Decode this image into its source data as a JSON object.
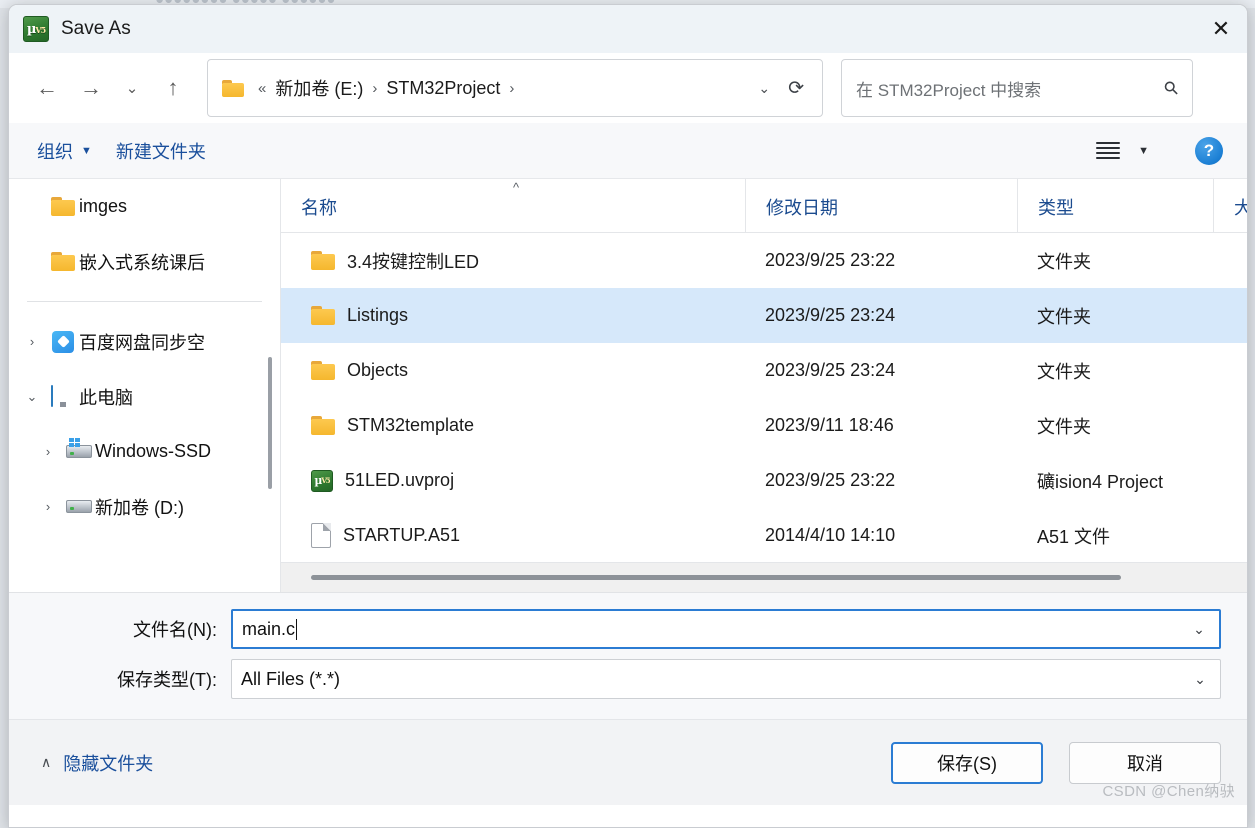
{
  "background": {
    "ghost_text": "●●●●●●●● ●●●●● ●●●●●●"
  },
  "titlebar": {
    "app_icon": "keil-uvision-icon",
    "title": "Save As",
    "close_label": "✕"
  },
  "nav": {
    "back": "←",
    "forward": "→",
    "recent": "⌄",
    "up": "↑",
    "address": {
      "folder_icon": "folder-icon",
      "prefix": "«",
      "crumbs": [
        {
          "label": "新加卷 (E:)",
          "sep": "›"
        },
        {
          "label": "STM32Project",
          "sep": "›"
        }
      ],
      "history_chev": "⌄",
      "refresh": "⟳"
    },
    "search": {
      "placeholder": "在 STM32Project 中搜索",
      "icon": "search-icon"
    }
  },
  "toolbar": {
    "organize_label": "组织",
    "organize_caret": "▼",
    "new_folder_label": "新建文件夹",
    "view_caret": "▼",
    "help_label": "?"
  },
  "sidebar": {
    "items": [
      {
        "chev": "",
        "icon": "folder-icon",
        "label": "imges",
        "indent": false
      },
      {
        "chev": "",
        "icon": "folder-icon",
        "label": "嵌入式系统课后",
        "indent": false
      },
      {
        "separator": true
      },
      {
        "chev": "›",
        "icon": "cloud-icon",
        "label": "百度网盘同步空",
        "indent": false
      },
      {
        "chev": "⌄",
        "icon": "pc-icon",
        "label": "此电脑",
        "indent": false
      },
      {
        "chev": "›",
        "icon": "win-drive-icon",
        "label": "Windows-SSD",
        "indent": true
      },
      {
        "chev": "›",
        "icon": "drive-icon",
        "label": "新加卷 (D:)",
        "indent": true
      }
    ]
  },
  "filelist": {
    "columns": [
      {
        "key": "name",
        "label": "名称",
        "sorted": true,
        "sort_caret": "^"
      },
      {
        "key": "date",
        "label": "修改日期",
        "sorted": false
      },
      {
        "key": "type",
        "label": "类型",
        "sorted": false
      },
      {
        "key": "size",
        "label": "大",
        "sorted": false
      }
    ],
    "rows": [
      {
        "icon": "folder-icon",
        "name": "3.4按键控制LED",
        "date": "2023/9/25 23:22",
        "type": "文件夹",
        "size": "",
        "selected": false
      },
      {
        "icon": "folder-icon",
        "name": "Listings",
        "date": "2023/9/25 23:24",
        "type": "文件夹",
        "size": "",
        "selected": true
      },
      {
        "icon": "folder-icon",
        "name": "Objects",
        "date": "2023/9/25 23:24",
        "type": "文件夹",
        "size": "",
        "selected": false
      },
      {
        "icon": "folder-icon",
        "name": "STM32template",
        "date": "2023/9/11 18:46",
        "type": "文件夹",
        "size": "",
        "selected": false
      },
      {
        "icon": "uvision-icon",
        "name": "51LED.uvproj",
        "date": "2023/9/25 23:22",
        "type": "礦ision4 Project",
        "size": "",
        "selected": false
      },
      {
        "icon": "file-icon",
        "name": "STARTUP.A51",
        "date": "2014/4/10 14:10",
        "type": "A51 文件",
        "size": "",
        "selected": false
      }
    ]
  },
  "form": {
    "filename_label": "文件名(N):",
    "filename_value": "main.c",
    "savetype_label": "保存类型(T):",
    "savetype_value": "All Files (*.*)",
    "savetype_chev": "⌄",
    "filename_chev": "⌄"
  },
  "footer": {
    "hide_folders_chev": "∧",
    "hide_folders_label": "隐藏文件夹",
    "save_label": "保存(S)",
    "cancel_label": "取消",
    "watermark": "CSDN @Chen纳𫘝"
  }
}
